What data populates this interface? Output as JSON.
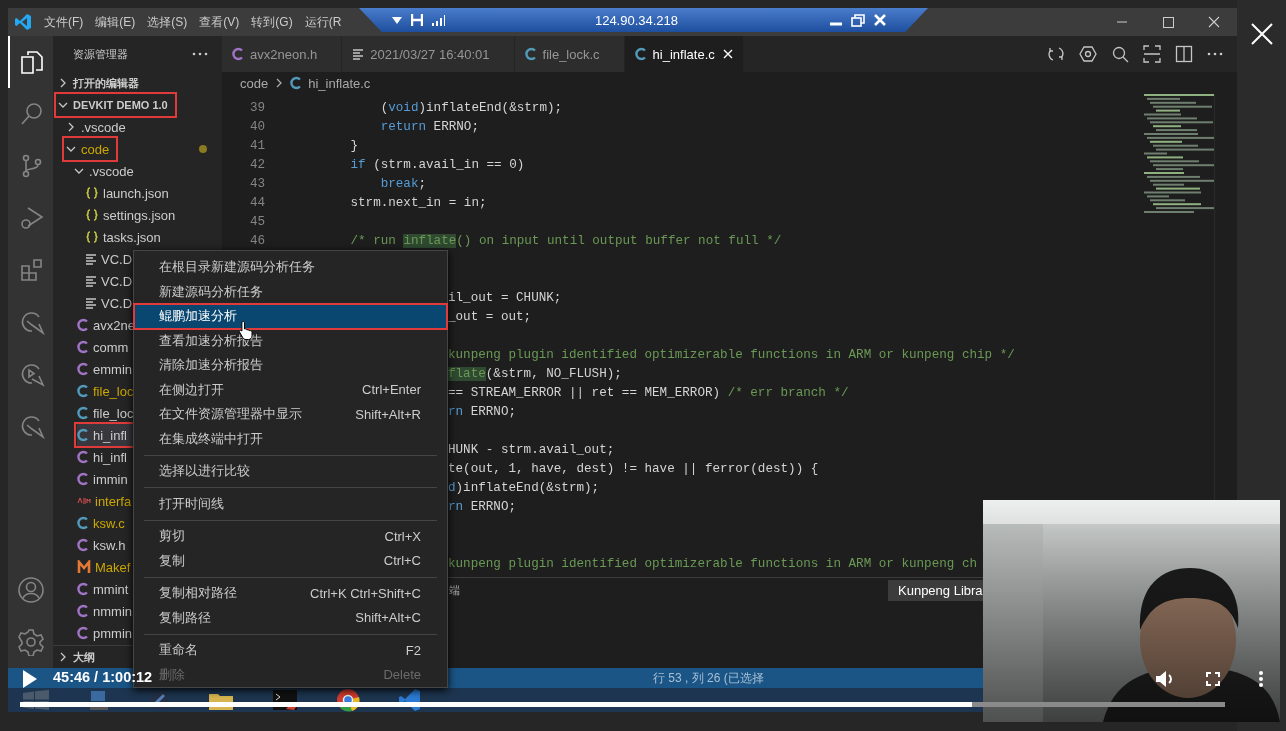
{
  "title_bar": {
    "menus": [
      "文件(F)",
      "编辑(E)",
      "选择(S)",
      "查看(V)",
      "转到(G)",
      "运行(R"
    ]
  },
  "remote_bar": {
    "address": "124.90.34.218"
  },
  "activity_bar": {
    "items": [
      {
        "kind": "explorer",
        "selected": true
      },
      {
        "kind": "search",
        "selected": false
      },
      {
        "kind": "source-control",
        "selected": false
      },
      {
        "kind": "debug",
        "selected": false
      },
      {
        "kind": "extensions",
        "selected": false
      },
      {
        "kind": "gauge",
        "selected": false
      },
      {
        "kind": "gauge-play",
        "selected": false
      },
      {
        "kind": "gauge",
        "selected": false
      }
    ],
    "bottom": [
      {
        "kind": "account"
      },
      {
        "kind": "settings"
      }
    ]
  },
  "sidebar": {
    "title": "资源管理器",
    "tree": [
      {
        "label": "打开的编辑器",
        "kind": "section",
        "expanded": false,
        "selected": false,
        "marked": false,
        "modified": false
      },
      {
        "label": "DEVKIT DEMO 1.0",
        "kind": "section",
        "expanded": true,
        "selected": false,
        "marked": true,
        "modified": false,
        "children": [
          {
            "label": ".vscode",
            "kind": "folder",
            "expanded": false,
            "selected": false,
            "marked": false,
            "modified": false
          },
          {
            "label": "code",
            "kind": "folder",
            "expanded": true,
            "selected": false,
            "marked": true,
            "modified": true,
            "children": [
              {
                "label": ".vscode",
                "kind": "folder",
                "expanded": true,
                "selected": false,
                "marked": false,
                "modified": false,
                "children": [
                  {
                    "label": "launch.json",
                    "kind": "json",
                    "selected": false,
                    "marked": false,
                    "modified": false
                  },
                  {
                    "label": "settings.json",
                    "kind": "json",
                    "selected": false,
                    "marked": false,
                    "modified": false
                  },
                  {
                    "label": "tasks.json",
                    "kind": "json",
                    "selected": false,
                    "marked": false,
                    "modified": false
                  },
                  {
                    "label": "VC.D",
                    "kind": "text",
                    "selected": false,
                    "marked": false,
                    "modified": false
                  },
                  {
                    "label": "VC.D",
                    "kind": "text",
                    "selected": false,
                    "marked": false,
                    "modified": false
                  },
                  {
                    "label": "VC.D",
                    "kind": "text",
                    "selected": false,
                    "marked": false,
                    "modified": false
                  }
                ]
              },
              {
                "label": "avx2ne",
                "kind": "h",
                "selected": false,
                "marked": false,
                "modified": false
              },
              {
                "label": "comm",
                "kind": "h",
                "selected": false,
                "marked": false,
                "modified": false
              },
              {
                "label": "emmin",
                "kind": "h",
                "selected": false,
                "marked": false,
                "modified": false
              },
              {
                "label": "file_loc",
                "kind": "c",
                "selected": false,
                "marked": false,
                "modified": true
              },
              {
                "label": "file_loc",
                "kind": "c",
                "selected": false,
                "marked": false,
                "modified": false
              },
              {
                "label": "hi_infl",
                "kind": "c",
                "selected": true,
                "marked": true,
                "modified": false
              },
              {
                "label": "hi_infl",
                "kind": "h",
                "selected": false,
                "marked": false,
                "modified": false
              },
              {
                "label": "immin",
                "kind": "h",
                "selected": false,
                "marked": false,
                "modified": false
              },
              {
                "label": "interfa",
                "kind": "asm",
                "selected": false,
                "marked": false,
                "modified": true
              },
              {
                "label": "ksw.c",
                "kind": "c",
                "selected": false,
                "marked": false,
                "modified": true
              },
              {
                "label": "ksw.h",
                "kind": "h",
                "selected": false,
                "marked": false,
                "modified": false
              },
              {
                "label": "Makef",
                "kind": "make",
                "selected": false,
                "marked": false,
                "modified": true
              },
              {
                "label": "mmint",
                "kind": "h",
                "selected": false,
                "marked": false,
                "modified": false
              },
              {
                "label": "nmmin",
                "kind": "h",
                "selected": false,
                "marked": false,
                "modified": false
              },
              {
                "label": "pmmin",
                "kind": "h",
                "selected": false,
                "marked": false,
                "modified": false
              }
            ]
          }
        ]
      }
    ],
    "outline": {
      "label": "大纲",
      "expanded": false
    }
  },
  "editor": {
    "tabs": [
      {
        "label": "avx2neon.h",
        "kind": "h",
        "selected": false
      },
      {
        "label": "2021/03/27 16:40:01",
        "kind": "text",
        "selected": false
      },
      {
        "label": "file_lock.c",
        "kind": "c",
        "selected": false
      },
      {
        "label": "hi_inflate.c",
        "kind": "c",
        "selected": true
      }
    ],
    "breadcrumb": {
      "folder": "code",
      "file": "hi_inflate.c",
      "kind": "c"
    },
    "lines": [
      {
        "kind": "numbered",
        "number": "39",
        "segments": [
          {
            "text": "            (",
            "kind": "plain"
          },
          {
            "text": "void",
            "kind": "keyword"
          },
          {
            "text": ")inflateEnd(&strm);",
            "kind": "plain"
          }
        ]
      },
      {
        "kind": "numbered",
        "number": "40",
        "segments": [
          {
            "text": "            return",
            "kind": "keyword"
          },
          {
            "text": " ERRNO;",
            "kind": "plain"
          }
        ]
      },
      {
        "kind": "numbered",
        "number": "41",
        "segments": [
          {
            "text": "        }",
            "kind": "plain"
          }
        ]
      },
      {
        "kind": "numbered",
        "number": "42",
        "segments": [
          {
            "text": "        if",
            "kind": "keyword"
          },
          {
            "text": " (strm.avail_in == 0)",
            "kind": "plain"
          }
        ]
      },
      {
        "kind": "numbered",
        "number": "43",
        "segments": [
          {
            "text": "            break",
            "kind": "keyword"
          },
          {
            "text": ";",
            "kind": "plain"
          }
        ]
      },
      {
        "kind": "numbered",
        "number": "44",
        "segments": [
          {
            "text": "        strm.next_in = in;",
            "kind": "plain"
          }
        ]
      },
      {
        "kind": "numbered",
        "number": "45"
      },
      {
        "kind": "numbered",
        "number": "46",
        "segments": [
          {
            "text": "        /* run ",
            "kind": "comment"
          },
          {
            "text": "inflate",
            "kind": "match"
          },
          {
            "text": "() on input until output buffer not full */",
            "kind": "comment"
          }
        ]
      },
      {
        "kind": "clipped"
      },
      {
        "kind": "clipped"
      },
      {
        "kind": "clipped",
        "segments": [
          {
            "text": "il_out = CHUNK;",
            "kind": "plain"
          }
        ]
      },
      {
        "kind": "clipped",
        "segments": [
          {
            "text": "_out = out;",
            "kind": "plain"
          }
        ]
      },
      {
        "kind": "clipped"
      },
      {
        "kind": "clipped",
        "segments": [
          {
            "text": "kunpeng plugin identified optimizerable functions in ARM or kunpeng chip */",
            "kind": "comment"
          }
        ]
      },
      {
        "kind": "clipped",
        "segments": [
          {
            "text": "flate",
            "kind": "match"
          },
          {
            "text": "(&strm, NO_FLUSH);",
            "kind": "plain"
          }
        ]
      },
      {
        "kind": "clipped",
        "segments": [
          {
            "text": "== STREAM_ERROR || ret == MEM_ERROR) ",
            "kind": "plain"
          },
          {
            "text": "/* err branch */",
            "kind": "comment"
          }
        ]
      },
      {
        "kind": "clipped",
        "segments": [
          {
            "text": "rn",
            "kind": "keyword"
          },
          {
            "text": " ERRNO;",
            "kind": "plain"
          }
        ]
      },
      {
        "kind": "clipped"
      },
      {
        "kind": "clipped",
        "segments": [
          {
            "text": "HUNK - strm.avail_out;",
            "kind": "plain"
          }
        ]
      },
      {
        "kind": "clipped",
        "segments": [
          {
            "text": "te(out, 1, have, dest) != have || ferror(dest)) {",
            "kind": "plain"
          }
        ]
      },
      {
        "kind": "clipped",
        "segments": [
          {
            "text": "d",
            "kind": "keyword"
          },
          {
            "text": ")inflateEnd(&strm);",
            "kind": "plain"
          }
        ]
      },
      {
        "kind": "clipped",
        "segments": [
          {
            "text": "rn",
            "kind": "keyword"
          },
          {
            "text": " ERRNO;",
            "kind": "plain"
          }
        ]
      },
      {
        "kind": "clipped"
      },
      {
        "kind": "clipped"
      },
      {
        "kind": "clipped",
        "segments": [
          {
            "text": "kunpeng plugin identified optimizerable functions in ARM or kunpeng ch",
            "kind": "comment"
          }
        ]
      }
    ],
    "panel": {
      "tab": "端"
    },
    "tooltip": {
      "text": "Kunpeng Libra"
    }
  },
  "context_menu": {
    "groups": [
      {
        "items": [
          {
            "label": "在根目录新建源码分析任务",
            "selected": false,
            "disabled": false,
            "marked": false
          },
          {
            "label": "新建源码分析任务",
            "selected": false,
            "disabled": false,
            "marked": false
          },
          {
            "label": "鲲鹏加速分析",
            "selected": true,
            "disabled": false,
            "marked": true
          },
          {
            "label": "查看加速分析报告",
            "selected": false,
            "disabled": false,
            "marked": false
          },
          {
            "label": "清除加速分析报告",
            "selected": false,
            "disabled": false,
            "marked": false
          },
          {
            "label": "在侧边打开",
            "shortcut": "Ctrl+Enter",
            "selected": false,
            "disabled": false,
            "marked": false
          },
          {
            "label": "在文件资源管理器中显示",
            "shortcut": "Shift+Alt+R",
            "selected": false,
            "disabled": false,
            "marked": false
          },
          {
            "label": "在集成终端中打开",
            "selected": false,
            "disabled": false,
            "marked": false
          }
        ]
      },
      {
        "items": [
          {
            "label": "选择以进行比较",
            "selected": false,
            "disabled": false,
            "marked": false
          }
        ]
      },
      {
        "items": [
          {
            "label": "打开时间线",
            "selected": false,
            "disabled": false,
            "marked": false
          }
        ]
      },
      {
        "items": [
          {
            "label": "剪切",
            "shortcut": "Ctrl+X",
            "selected": false,
            "disabled": false,
            "marked": false
          },
          {
            "label": "复制",
            "shortcut": "Ctrl+C",
            "selected": false,
            "disabled": false,
            "marked": false
          }
        ]
      },
      {
        "items": [
          {
            "label": "复制相对路径",
            "shortcut": "Ctrl+K Ctrl+Shift+C",
            "selected": false,
            "disabled": false,
            "marked": false
          },
          {
            "label": "复制路径",
            "shortcut": "Shift+Alt+C",
            "selected": false,
            "disabled": false,
            "marked": false
          }
        ]
      },
      {
        "items": [
          {
            "label": "重命名",
            "shortcut": "F2",
            "selected": false,
            "disabled": false,
            "marked": false
          },
          {
            "label": "删除",
            "shortcut": "Delete",
            "selected": false,
            "disabled": true,
            "marked": false
          }
        ]
      }
    ]
  },
  "status_bar": {
    "position": "行 53 , 列 26 (已选择"
  },
  "video": {
    "time": "45:46 / 1:00:12",
    "progress": {
      "level": 0.79
    }
  }
}
